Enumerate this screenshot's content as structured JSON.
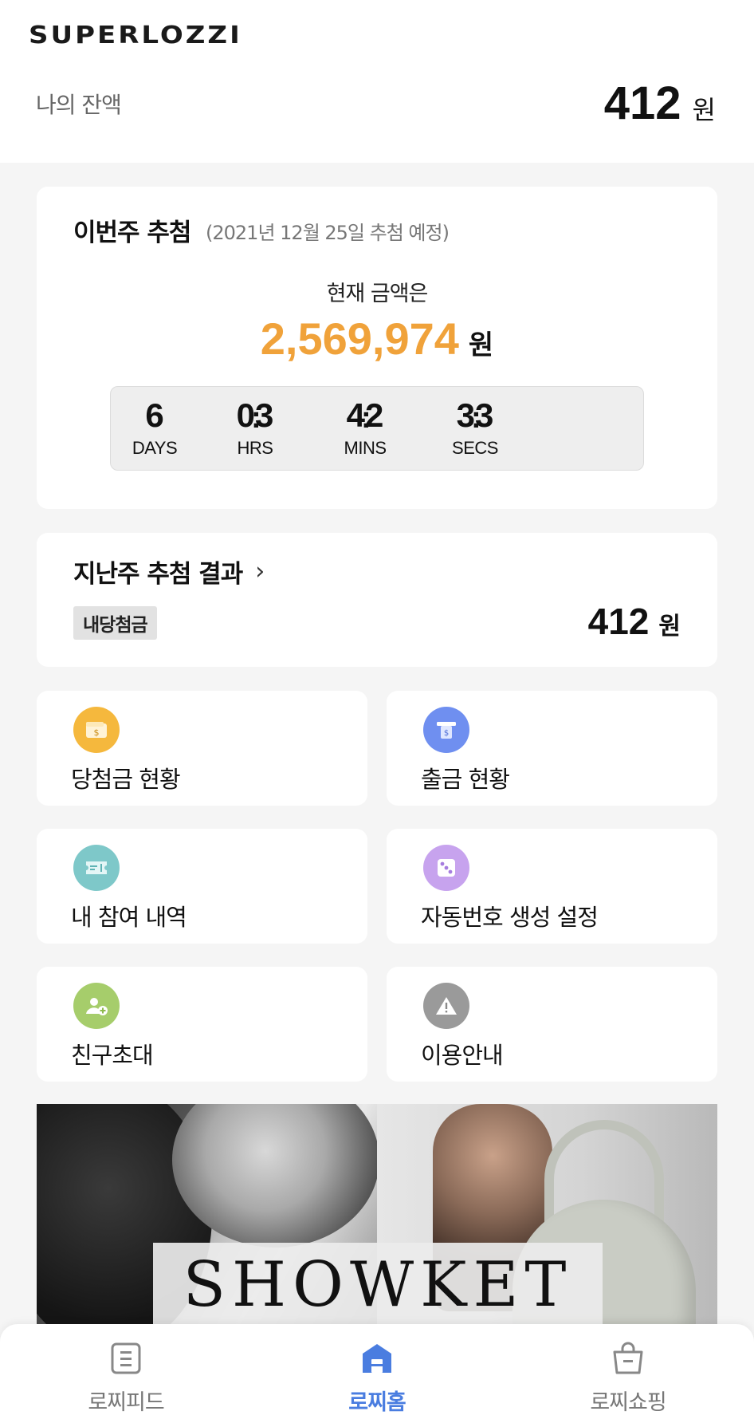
{
  "header": {
    "logo": "SUPERLOZZI",
    "balance_label": "나의 잔액",
    "balance_value": "412",
    "balance_unit": "원"
  },
  "weekly_draw": {
    "title": "이번주 추첨",
    "subtitle": "(2021년 12월 25일 추첨 예정)",
    "current_label": "현재 금액은",
    "current_amount": "2,569,974",
    "current_unit": "원",
    "accent_color": "#f0a23a",
    "countdown": [
      {
        "value": "6",
        "label": "DAYS"
      },
      {
        "value": "03",
        "label": "HRS"
      },
      {
        "value": "42",
        "label": "MINS"
      },
      {
        "value": "33",
        "label": "SECS"
      }
    ],
    "separator": ":"
  },
  "last_draw": {
    "title": "지난주 추첨 결과",
    "chevron": "›",
    "badge": "내당첨금",
    "amount": "412",
    "unit": "원"
  },
  "menu": [
    {
      "label": "당첨금 현황",
      "icon": "wallet-icon",
      "color": "#f5b83d"
    },
    {
      "label": "출금 현황",
      "icon": "atm-icon",
      "color": "#6f8ff0"
    },
    {
      "label": "내 참여 내역",
      "icon": "ticket-icon",
      "color": "#7ec8c9"
    },
    {
      "label": "자동번호 생성 설정",
      "icon": "dice-icon",
      "color": "#c7a3ee"
    },
    {
      "label": "친구초대",
      "icon": "add-friend-icon",
      "color": "#a6cd6b"
    },
    {
      "label": "이용안내",
      "icon": "info-warning-icon",
      "color": "#9a9a9a"
    }
  ],
  "banner": {
    "brand": "SHOWKET"
  },
  "bottom_nav": [
    {
      "label": "로찌피드",
      "icon": "feed-icon",
      "active": false
    },
    {
      "label": "로찌홈",
      "icon": "home-icon",
      "active": true
    },
    {
      "label": "로찌쇼핑",
      "icon": "shopping-bag-icon",
      "active": false
    }
  ]
}
